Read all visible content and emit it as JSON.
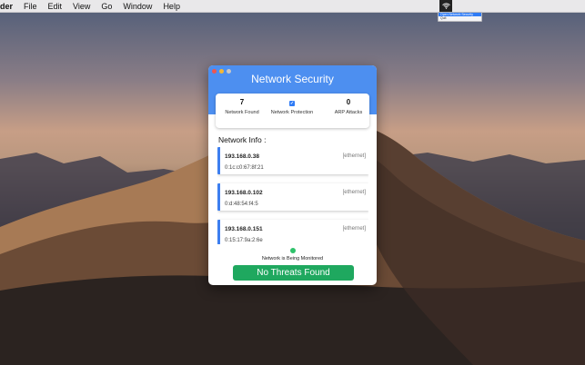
{
  "menubar": {
    "app_name": "der",
    "items": [
      "File",
      "Edit",
      "View",
      "Go",
      "Window",
      "Help"
    ],
    "status_icon": "wifi-icon"
  },
  "status_dropdown": {
    "items": [
      "Open Network Security",
      "Quit"
    ]
  },
  "window": {
    "title": "Network Security",
    "stats": [
      {
        "value": "7",
        "label": "Network Found"
      },
      {
        "value": "",
        "label": "Network Protection",
        "icon": "checkbox-checked-icon"
      },
      {
        "value": "0",
        "label": "ARP Attacks"
      }
    ],
    "section_title": "Network Info :",
    "networks": [
      {
        "ip": "193.168.0.38",
        "type": "[ethernet]",
        "mac": "0:1c:c0:67:8f:21"
      },
      {
        "ip": "193.168.0.102",
        "type": "[ethernet]",
        "mac": "0:d:48:54:f4:5"
      },
      {
        "ip": "193.168.0.151",
        "type": "[ethernet]",
        "mac": "0:15:17:9a:2:6e"
      }
    ],
    "status_text": "Network is Being Monitored",
    "status_button": "No Threats Found"
  },
  "colors": {
    "accent": "#4d8ff0",
    "success": "#1fa85f",
    "status_dot": "#2ec26b"
  }
}
